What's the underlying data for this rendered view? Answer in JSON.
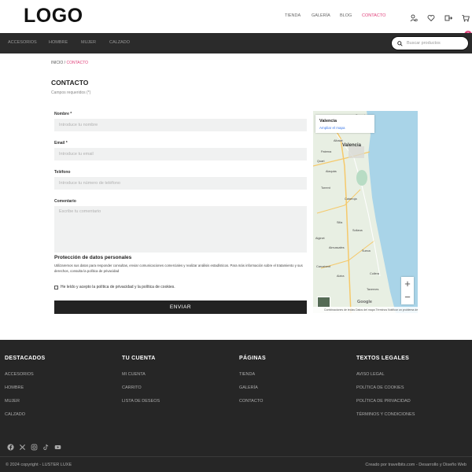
{
  "header": {
    "logo": "LOGO",
    "nav": [
      {
        "label": "TIENDA",
        "active": false
      },
      {
        "label": "GALERÍA",
        "active": false
      },
      {
        "label": "BLOG",
        "active": false
      },
      {
        "label": "CONTACTO",
        "active": true
      }
    ],
    "icons": [
      "user-icon",
      "heart-icon",
      "logout-icon",
      "cart-icon"
    ],
    "cart_count": "0"
  },
  "catnav": {
    "items": [
      "ACCESORIOS",
      "HOMBRE",
      "MUJER",
      "CALZADO"
    ],
    "search_placeholder": "Buscar productos"
  },
  "breadcrumb": {
    "home": "INICIO",
    "sep": " / ",
    "current": "CONTACTO"
  },
  "page": {
    "title": "CONTACTO",
    "required_note": "Campos requeridos (*)"
  },
  "form": {
    "name_label": "Nombre *",
    "name_placeholder": "Introduce tu nombre",
    "email_label": "Email *",
    "email_placeholder": "Introduce tu email",
    "phone_label": "Teléfono",
    "phone_placeholder": "Introduce tu número de teléfono",
    "comment_label": "Comentario",
    "comment_placeholder": "Escribe tu comentario",
    "privacy_title": "Protección de datos personales",
    "privacy_text": "Utilizaremos sus datos para responder consultas, enviar comunicaciones comerciales y realizar análisis estadísticos. Para más información sobre el tratamiento y sus derechos, consulta la política de privacidad",
    "consent_label": "He leído y acepto la política de privacidad y la política de cookies.",
    "submit_label": "ENVIAR"
  },
  "map": {
    "place": "Valencia",
    "link": "Ampliar el mapa",
    "city_label": "Valencia",
    "towns": [
      "Sagunto",
      "Puzol",
      "Albalat",
      "Paterna",
      "Quart",
      "Alaquàs",
      "Torrent",
      "Catarroja",
      "Silla",
      "Alginet",
      "Almussafes",
      "Sueca",
      "Carcaixent",
      "Alzira",
      "Cullera",
      "Sollana",
      "Tavernes"
    ],
    "google": "Google",
    "footer_text": "Combinaciones de teclas   Datos del mapa   Términos   Notificar un problema de Maps",
    "zoom_in": "+",
    "zoom_out": "−",
    "colors": {
      "sea": "#a9d4e8",
      "land": "#e8efe3",
      "road": "#f5c96b"
    }
  },
  "footer": {
    "columns": [
      {
        "title": "DESTACADOS",
        "links": [
          "ACCESORIOS",
          "HOMBRE",
          "MUJER",
          "CALZADO"
        ]
      },
      {
        "title": "TU CUENTA",
        "links": [
          "MI CUENTA",
          "CARRITO",
          "LISTA DE DESEOS"
        ]
      },
      {
        "title": "PÁGINAS",
        "links": [
          "TIENDA",
          "GALERÍA",
          "CONTACTO"
        ]
      },
      {
        "title": "TEXTOS LEGALES",
        "links": [
          "AVISO LEGAL",
          "POLÍTICA DE COOKIES",
          "POLÍTICA DE PRIVACIDAD",
          "TÉRMINOS Y CONDICIONES"
        ]
      }
    ],
    "social": [
      "facebook-icon",
      "x-icon",
      "instagram-icon",
      "tiktok-icon",
      "youtube-icon"
    ],
    "copyright": "© 2024 copyright - LUSTER LUXE",
    "credit": "Creado por travelbits.com - Desarrollo y Diseño Web"
  },
  "colors": {
    "accent": "#e0407a",
    "dark": "#2b2b2b",
    "footer": "#262626"
  }
}
